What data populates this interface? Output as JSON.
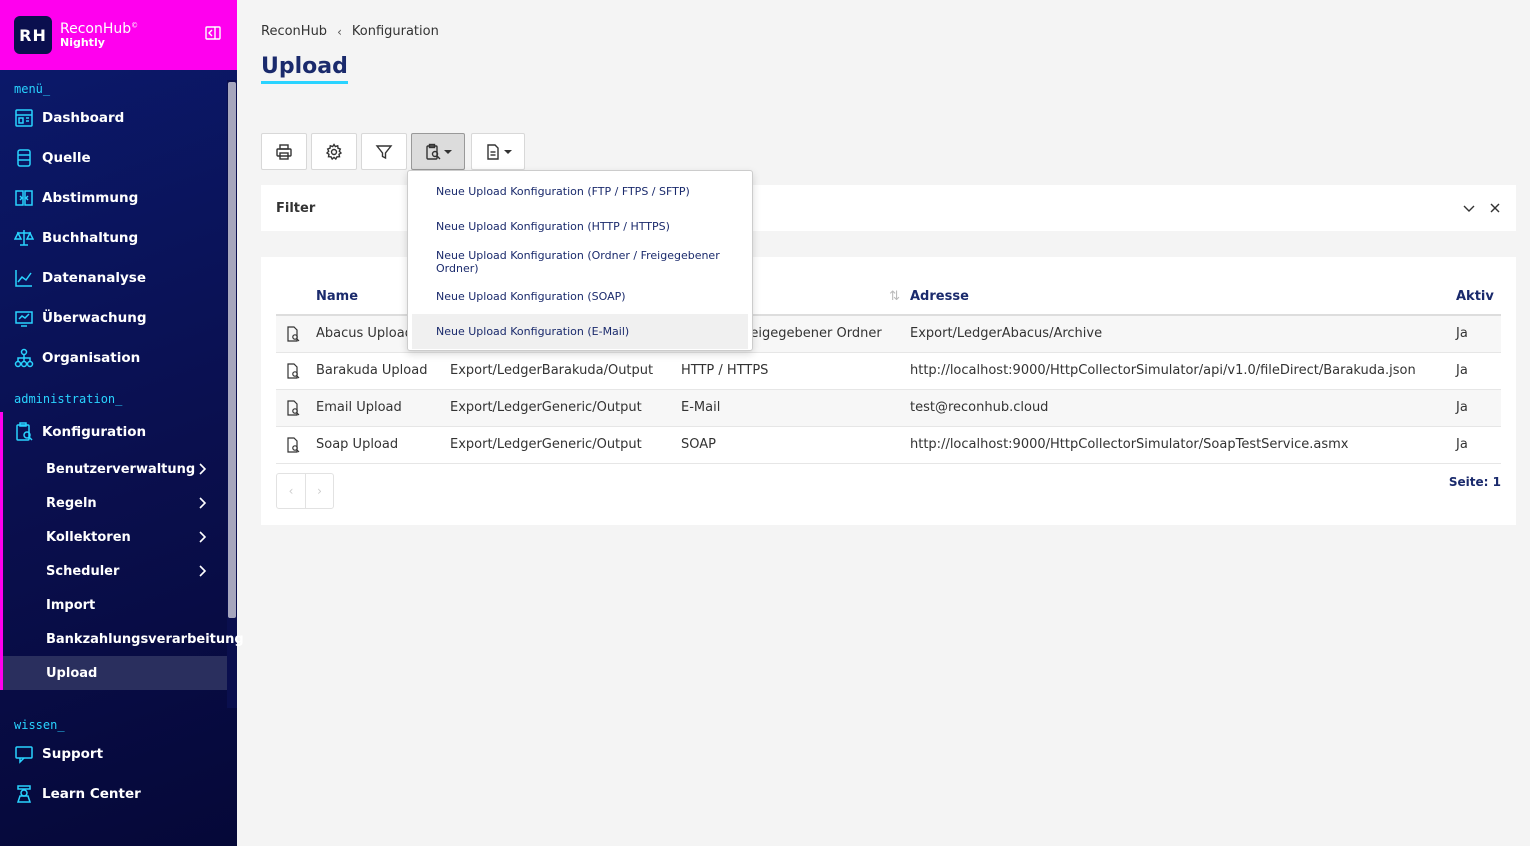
{
  "brand": {
    "logo": "RH",
    "name": "ReconHub",
    "sub": "Nightly"
  },
  "sidebar": {
    "menu_title": "menü_",
    "menu_items": [
      {
        "label": "Dashboard",
        "icon": "dashboard-icon"
      },
      {
        "label": "Quelle",
        "icon": "database-icon"
      },
      {
        "label": "Abstimmung",
        "icon": "compare-icon"
      },
      {
        "label": "Buchhaltung",
        "icon": "scale-icon"
      },
      {
        "label": "Datenanalyse",
        "icon": "chart-line-icon"
      },
      {
        "label": "Überwachung",
        "icon": "monitor-icon"
      },
      {
        "label": "Organisation",
        "icon": "org-tree-icon"
      }
    ],
    "admin_title": "administration_",
    "admin_item": {
      "label": "Konfiguration",
      "icon": "config-icon"
    },
    "admin_sub_items": [
      {
        "label": "Benutzerverwaltung",
        "chevron": true
      },
      {
        "label": "Regeln",
        "chevron": true
      },
      {
        "label": "Kollektoren",
        "chevron": true
      },
      {
        "label": "Scheduler",
        "chevron": true
      },
      {
        "label": "Import",
        "chevron": false
      },
      {
        "label": "Bankzahlungsverarbeitung",
        "chevron": false
      },
      {
        "label": "Upload",
        "chevron": false,
        "active": true
      }
    ],
    "wissen_title": "wissen_",
    "wissen_items": [
      {
        "label": "Support",
        "icon": "support-icon"
      },
      {
        "label": "Learn Center",
        "icon": "learn-icon"
      }
    ]
  },
  "breadcrumb": {
    "root": "ReconHub",
    "current": "Konfiguration"
  },
  "page": {
    "title": "Upload"
  },
  "filter": {
    "label": "Filter"
  },
  "dropdown": {
    "items": [
      "Neue Upload Konfiguration (FTP / FTPS / SFTP)",
      "Neue Upload Konfiguration (HTTP / HTTPS)",
      "Neue Upload Konfiguration (Ordner / Freigegebener Ordner)",
      "Neue Upload Konfiguration (SOAP)",
      "Neue Upload Konfiguration (E-Mail)"
    ]
  },
  "table": {
    "headers": {
      "name": "Name",
      "path": "",
      "type": "",
      "address": "Adresse",
      "active": "Aktiv"
    },
    "rows": [
      {
        "name": "Abacus Upload",
        "path": "",
        "type": "Ordner / Freigegebener Ordner",
        "address": "Export/LedgerAbacus/Archive",
        "active": "Ja"
      },
      {
        "name": "Barakuda Upload",
        "path": "Export/LedgerBarakuda/Output",
        "type": "HTTP / HTTPS",
        "address": "http://localhost:9000/HttpCollectorSimulator/api/v1.0/fileDirect/Barakuda.json",
        "active": "Ja"
      },
      {
        "name": "Email Upload",
        "path": "Export/LedgerGeneric/Output",
        "type": "E-Mail",
        "address": "test@reconhub.cloud",
        "active": "Ja"
      },
      {
        "name": "Soap Upload",
        "path": "Export/LedgerGeneric/Output",
        "type": "SOAP",
        "address": "http://localhost:9000/HttpCollectorSimulator/SoapTestService.asmx",
        "active": "Ja"
      }
    ]
  },
  "pager": {
    "prev": "‹",
    "next": "›",
    "page_info": "Seite: 1"
  },
  "colors": {
    "brand_pink": "#ff00ee",
    "accent_cyan": "#29d3ff",
    "nav_bg": "#0a0f4e",
    "title_blue": "#1a2a6c"
  }
}
